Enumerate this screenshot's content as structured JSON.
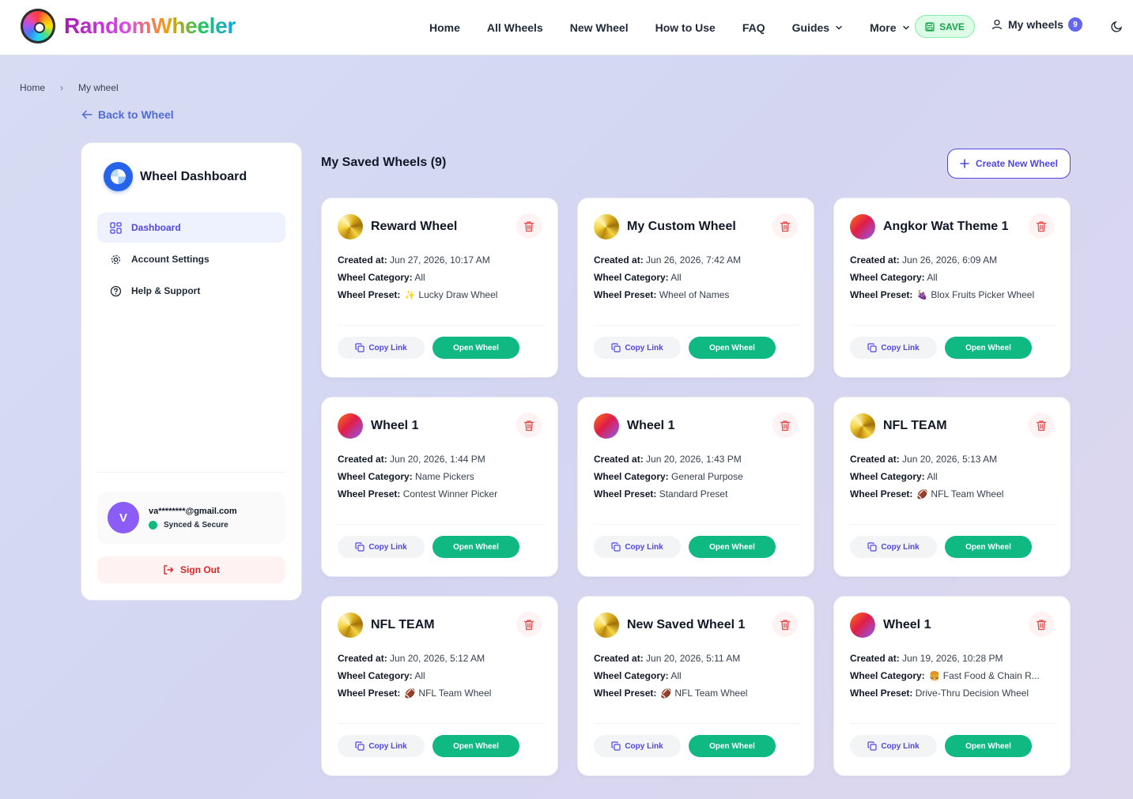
{
  "brand": {
    "name": "RandomWheeler"
  },
  "nav": {
    "items": [
      "Home",
      "All Wheels",
      "New Wheel",
      "How to Use",
      "FAQ",
      "Guides",
      "More"
    ],
    "save_label": "SAVE",
    "my_wheels_label": "My wheels",
    "my_wheels_count": "9"
  },
  "breadcrumb": {
    "home": "Home",
    "sep": "›",
    "current": "My wheel"
  },
  "back_label": "Back to Wheel",
  "sidebar": {
    "title": "Wheel Dashboard",
    "items": [
      {
        "label": "Dashboard",
        "icon": "grid-icon",
        "active": true
      },
      {
        "label": "Account Settings",
        "icon": "gear-icon"
      },
      {
        "label": "Help & Support",
        "icon": "help-icon"
      }
    ],
    "user": {
      "initial": "V",
      "email": "va********@gmail.com",
      "status": "Synced & Secure"
    },
    "signout_label": "Sign Out"
  },
  "main": {
    "title": "My Saved Wheels (9)",
    "create_label": "Create New Wheel",
    "labels": {
      "created": "Created at:",
      "category": "Wheel Category:",
      "preset": "Wheel Preset:"
    },
    "copy_label": "Copy Link",
    "open_label": "Open Wheel",
    "cards": [
      {
        "title": "Reward Wheel",
        "icon": "gold",
        "created": "Jun 27, 2026, 10:17 AM",
        "category": "All",
        "category_emoji": "",
        "preset": "Lucky Draw Wheel",
        "preset_emoji": "✨"
      },
      {
        "title": "My Custom Wheel",
        "icon": "gold",
        "created": "Jun 26, 2026, 7:42 AM",
        "category": "All",
        "category_emoji": "",
        "preset": "Wheel of Names",
        "preset_emoji": ""
      },
      {
        "title": "Angkor Wat Theme 1",
        "icon": "purple",
        "created": "Jun 26, 2026, 6:09 AM",
        "category": "All",
        "category_emoji": "",
        "preset": "Blox Fruits Picker Wheel",
        "preset_emoji": "🍇"
      },
      {
        "title": "Wheel 1",
        "icon": "purple",
        "created": "Jun 20, 2026, 1:44 PM",
        "category": "Name Pickers",
        "category_emoji": "",
        "preset": "Contest Winner Picker",
        "preset_emoji": ""
      },
      {
        "title": "Wheel 1",
        "icon": "purple",
        "created": "Jun 20, 2026, 1:43 PM",
        "category": "General Purpose",
        "category_emoji": "",
        "preset": "Standard Preset",
        "preset_emoji": ""
      },
      {
        "title": "NFL TEAM",
        "icon": "gold",
        "created": "Jun 20, 2026, 5:13 AM",
        "category": "All",
        "category_emoji": "",
        "preset": "NFL Team Wheel",
        "preset_emoji": "🏈"
      },
      {
        "title": "NFL TEAM",
        "icon": "gold",
        "created": "Jun 20, 2026, 5:12 AM",
        "category": "All",
        "category_emoji": "",
        "preset": "NFL Team Wheel",
        "preset_emoji": "🏈"
      },
      {
        "title": "New Saved Wheel 1",
        "icon": "gold",
        "created": "Jun 20, 2026, 5:11 AM",
        "category": "All",
        "category_emoji": "",
        "preset": "NFL Team Wheel",
        "preset_emoji": "🏈"
      },
      {
        "title": "Wheel 1",
        "icon": "purple",
        "created": "Jun 19, 2026, 10:28 PM",
        "category": "Fast Food & Chain R...",
        "category_emoji": "🍔",
        "preset": "Drive-Thru Decision Wheel",
        "preset_emoji": ""
      }
    ]
  }
}
